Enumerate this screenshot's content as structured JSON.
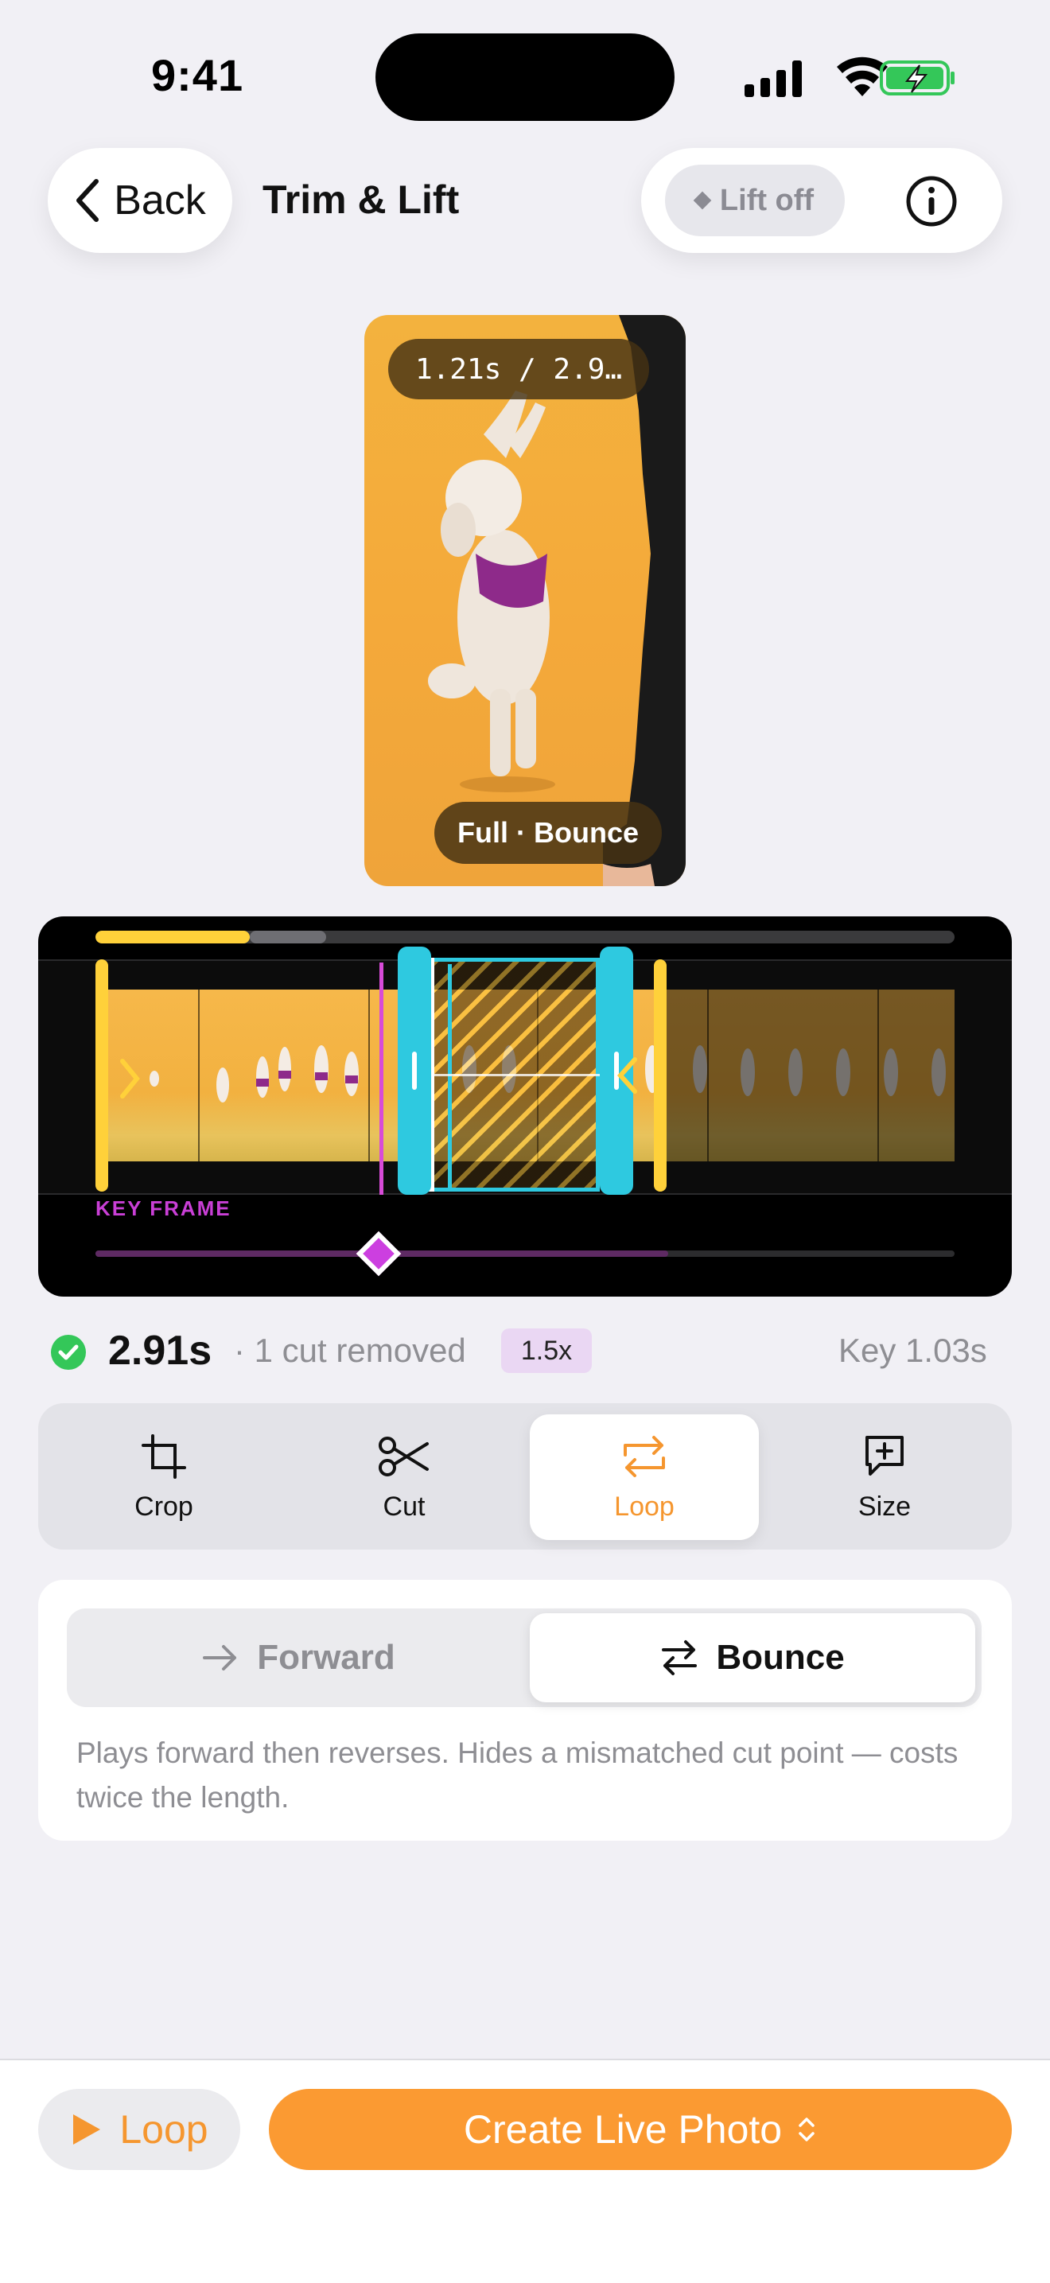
{
  "status_bar": {
    "time": "9:41"
  },
  "header": {
    "back_label": "Back",
    "title": "Trim & Lift",
    "lift_label": "Lift off"
  },
  "preview": {
    "time_readout": "1.21s / 2.9…",
    "mode": "Full · Bounce"
  },
  "timeline": {
    "keyframe_label": "KEY FRAME",
    "playback_progress": 0.18,
    "keyframe_position": 0.33
  },
  "summary": {
    "duration": "2.91s",
    "cuts": "· 1 cut removed",
    "speed": "1.5x",
    "key_time": "Key 1.03s"
  },
  "tools": [
    {
      "label": "Crop",
      "icon": "crop-icon"
    },
    {
      "label": "Cut",
      "icon": "scissors-icon"
    },
    {
      "label": "Loop",
      "icon": "loop-icon",
      "active": true
    },
    {
      "label": "Size",
      "icon": "size-icon"
    }
  ],
  "loop_mode": {
    "options": [
      "Forward",
      "Bounce"
    ],
    "selected": "Bounce",
    "description": "Plays forward then reverses. Hides a mismatched cut point — costs twice the length."
  },
  "bottom": {
    "loop_label": "Loop",
    "create_label": "Create Live Photo"
  },
  "colors": {
    "accent": "#fb9a32",
    "selection": "#2ec9e0",
    "trim": "#ffd13a",
    "keyframe": "#cc3fe0",
    "success": "#34c759"
  }
}
